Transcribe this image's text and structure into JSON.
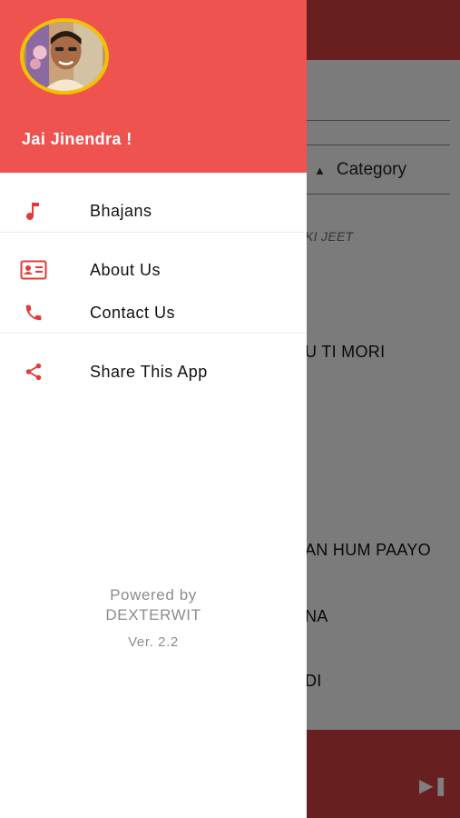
{
  "background": {
    "category_label": "Category",
    "song_rows": [
      "KI JEET",
      "U TI MORI",
      "",
      "AN HUM PAAYO",
      "NA",
      "DI"
    ]
  },
  "drawer": {
    "greeting": "Jai Jinendra !",
    "menu": [
      {
        "label": "Bhajans",
        "icon": "music-note-icon"
      },
      {
        "label": "About Us",
        "icon": "id-card-icon"
      },
      {
        "label": "Contact Us",
        "icon": "phone-icon"
      },
      {
        "label": "Share This App",
        "icon": "share-icon"
      }
    ],
    "footer": {
      "powered_by": "Powered by",
      "company": "DEXTERWIT",
      "version": "Ver. 2.2"
    }
  },
  "colors": {
    "accent": "#ef5350",
    "avatar_border": "#f2c200",
    "icon": "#e53935"
  }
}
